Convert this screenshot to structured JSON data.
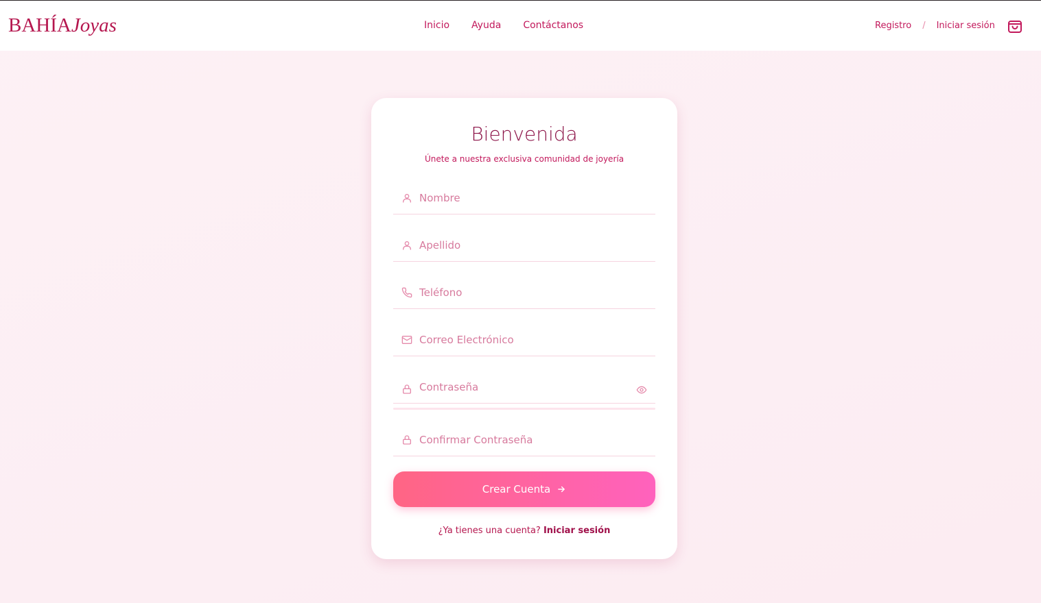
{
  "header": {
    "logo_part1": "BAHÍA",
    "logo_part2": "Joyas",
    "nav": [
      "Inicio",
      "Ayuda",
      "Contáctanos"
    ],
    "register_label": "Registro",
    "separator": "/",
    "login_label": "Iniciar sesión",
    "cart_icon": "shopping-bag-icon"
  },
  "form": {
    "title": "Bienvenida",
    "subtitle": "Únete a nuestra exclusiva comunidad de joyería",
    "fields": [
      {
        "placeholder": "Nombre",
        "icon": "user-icon",
        "value": ""
      },
      {
        "placeholder": "Apellido",
        "icon": "user-icon",
        "value": ""
      },
      {
        "placeholder": "Teléfono",
        "icon": "phone-icon",
        "value": ""
      },
      {
        "placeholder": "Correo Electrónico",
        "icon": "mail-icon",
        "value": ""
      },
      {
        "placeholder": "Contraseña",
        "icon": "lock-icon",
        "value": ""
      },
      {
        "placeholder": "Confirmar Contraseña",
        "icon": "lock-icon",
        "value": ""
      }
    ],
    "submit_label": "Crear Cuenta",
    "footer_question": "¿Ya tienes una cuenta?",
    "footer_link": "Iniciar sesión"
  },
  "colors": {
    "accent": "#c2185b",
    "title": "#8c1448",
    "button_start": "#ff6584",
    "button_end": "#ff62bd",
    "background": "#fdf1f5"
  }
}
